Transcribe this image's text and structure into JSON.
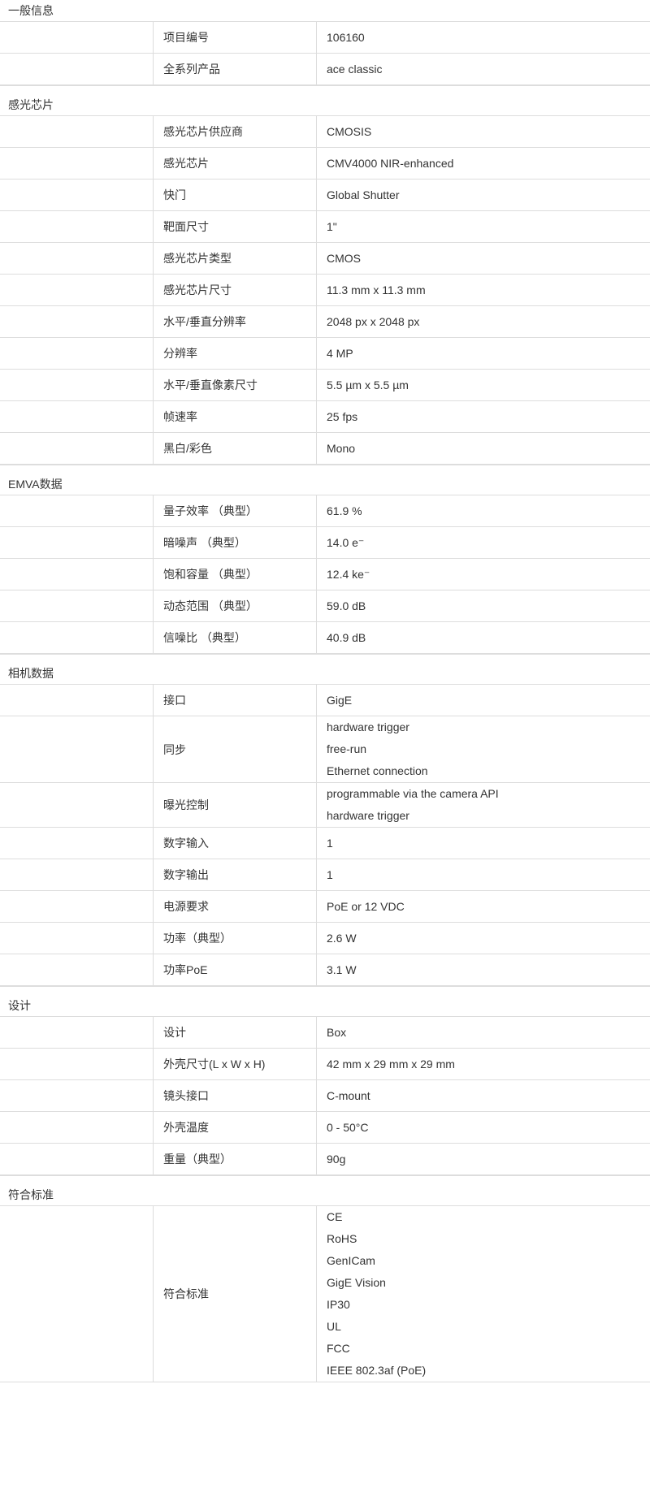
{
  "sections": [
    {
      "title": "一般信息",
      "rows": [
        {
          "label": "项目编号",
          "values": [
            "106160"
          ]
        },
        {
          "label": "全系列产品",
          "values": [
            "ace classic"
          ]
        }
      ]
    },
    {
      "title": "感光芯片",
      "rows": [
        {
          "label": "感光芯片供应商",
          "values": [
            "CMOSIS"
          ]
        },
        {
          "label": "感光芯片",
          "values": [
            "CMV4000 NIR-enhanced"
          ]
        },
        {
          "label": "快门",
          "values": [
            "Global Shutter"
          ]
        },
        {
          "label": "靶面尺寸",
          "values": [
            "1\""
          ]
        },
        {
          "label": "感光芯片类型",
          "values": [
            "CMOS"
          ]
        },
        {
          "label": "感光芯片尺寸",
          "values": [
            "11.3 mm x 11.3 mm"
          ]
        },
        {
          "label": "水平/垂直分辨率",
          "values": [
            "2048 px x 2048 px"
          ]
        },
        {
          "label": "分辨率",
          "values": [
            "4 MP"
          ]
        },
        {
          "label": "水平/垂直像素尺寸",
          "values": [
            "5.5 µm x 5.5 µm"
          ]
        },
        {
          "label": "帧速率",
          "values": [
            "25 fps"
          ]
        },
        {
          "label": "黑白/彩色",
          "values": [
            "Mono"
          ]
        }
      ]
    },
    {
      "title": "EMVA数据",
      "rows": [
        {
          "label": "量子效率 （典型）",
          "values": [
            "61.9 %"
          ]
        },
        {
          "label": "暗噪声 （典型）",
          "values": [
            "14.0 e⁻"
          ]
        },
        {
          "label": "饱和容量 （典型）",
          "values": [
            "12.4 ke⁻"
          ]
        },
        {
          "label": "动态范围 （典型）",
          "values": [
            "59.0 dB"
          ]
        },
        {
          "label": "信噪比 （典型）",
          "values": [
            "40.9 dB"
          ]
        }
      ]
    },
    {
      "title": "相机数据",
      "rows": [
        {
          "label": "接口",
          "values": [
            "GigE"
          ]
        },
        {
          "label": "同步",
          "values": [
            "hardware trigger",
            "free-run",
            "Ethernet connection"
          ]
        },
        {
          "label": "曝光控制",
          "values": [
            "programmable via the camera API",
            "hardware trigger"
          ]
        },
        {
          "label": "数字输入",
          "values": [
            "1"
          ]
        },
        {
          "label": "数字输出",
          "values": [
            "1"
          ]
        },
        {
          "label": "电源要求",
          "values": [
            "PoE or 12 VDC"
          ]
        },
        {
          "label": "功率（典型）",
          "values": [
            "2.6 W"
          ]
        },
        {
          "label": "功率PoE",
          "values": [
            "3.1 W"
          ]
        }
      ]
    },
    {
      "title": "设计",
      "rows": [
        {
          "label": "设计",
          "values": [
            "Box"
          ]
        },
        {
          "label": "外壳尺寸(L x W x H)",
          "values": [
            "42 mm x 29 mm x 29 mm"
          ]
        },
        {
          "label": "镜头接口",
          "values": [
            "C-mount"
          ]
        },
        {
          "label": "外壳温度",
          "values": [
            "0 - 50°C"
          ]
        },
        {
          "label": "重量（典型）",
          "values": [
            "90g"
          ]
        }
      ]
    },
    {
      "title": "符合标准",
      "rows": [
        {
          "label": "符合标准",
          "values": [
            "CE",
            "RoHS",
            "GenICam",
            "GigE Vision",
            "IP30",
            "UL",
            "FCC",
            "IEEE 802.3af (PoE)"
          ]
        }
      ]
    }
  ]
}
